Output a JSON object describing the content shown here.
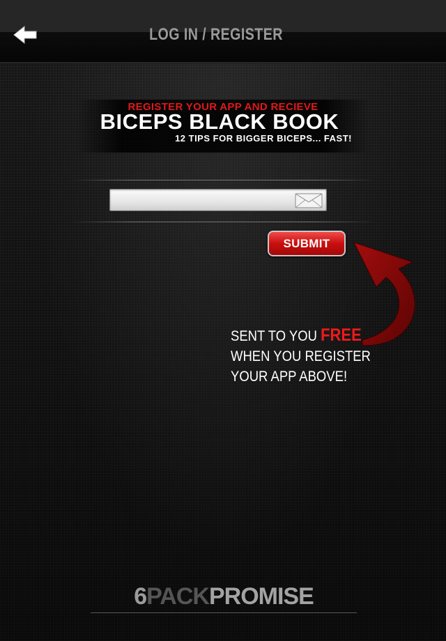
{
  "nav": {
    "title": "LOG IN / REGISTER",
    "back_icon": "back-arrow-icon"
  },
  "promo": {
    "eyebrow": "REGISTER YOUR APP AND RECIEVE",
    "title": "BICEPS BLACK BOOK",
    "subtitle": "12 TIPS FOR BIGGER BICEPS... FAST!"
  },
  "form": {
    "email_value": "",
    "email_placeholder": "",
    "email_icon": "envelope-icon",
    "submit_label": "SUBMIT"
  },
  "note": {
    "line1_prefix": "SENT TO YOU ",
    "line1_highlight": "FREE",
    "line2": "WHEN YOU REGISTER",
    "line3": "YOUR APP ABOVE!"
  },
  "brand": {
    "part1": "6",
    "part2": "PACK",
    "part3": "PROMISE"
  },
  "colors": {
    "accent_red": "#e01818",
    "background": "#161616",
    "nav_title": "#9a9a9a"
  }
}
